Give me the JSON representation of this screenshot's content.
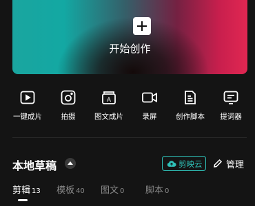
{
  "hero": {
    "label": "开始创作"
  },
  "tools": [
    {
      "label": "一键成片",
      "icon": "play-square-icon"
    },
    {
      "label": "拍摄",
      "icon": "camera-icon"
    },
    {
      "label": "图文成片",
      "icon": "text-image-icon"
    },
    {
      "label": "录屏",
      "icon": "video-camera-icon"
    },
    {
      "label": "创作脚本",
      "icon": "script-icon"
    },
    {
      "label": "提词器",
      "icon": "teleprompter-icon"
    }
  ],
  "drafts": {
    "title": "本地草稿",
    "cloud_label": "剪映云",
    "manage_label": "管理"
  },
  "tabs": [
    {
      "name": "剪辑",
      "count": "13",
      "active": true
    },
    {
      "name": "模板",
      "count": "40",
      "active": false
    },
    {
      "name": "图文",
      "count": "0",
      "active": false
    },
    {
      "name": "脚本",
      "count": "0",
      "active": false
    }
  ],
  "colors": {
    "background": "#141414",
    "accent": "#2fc0b7",
    "hero_left": "#13a8a3",
    "hero_right": "#e12752"
  }
}
